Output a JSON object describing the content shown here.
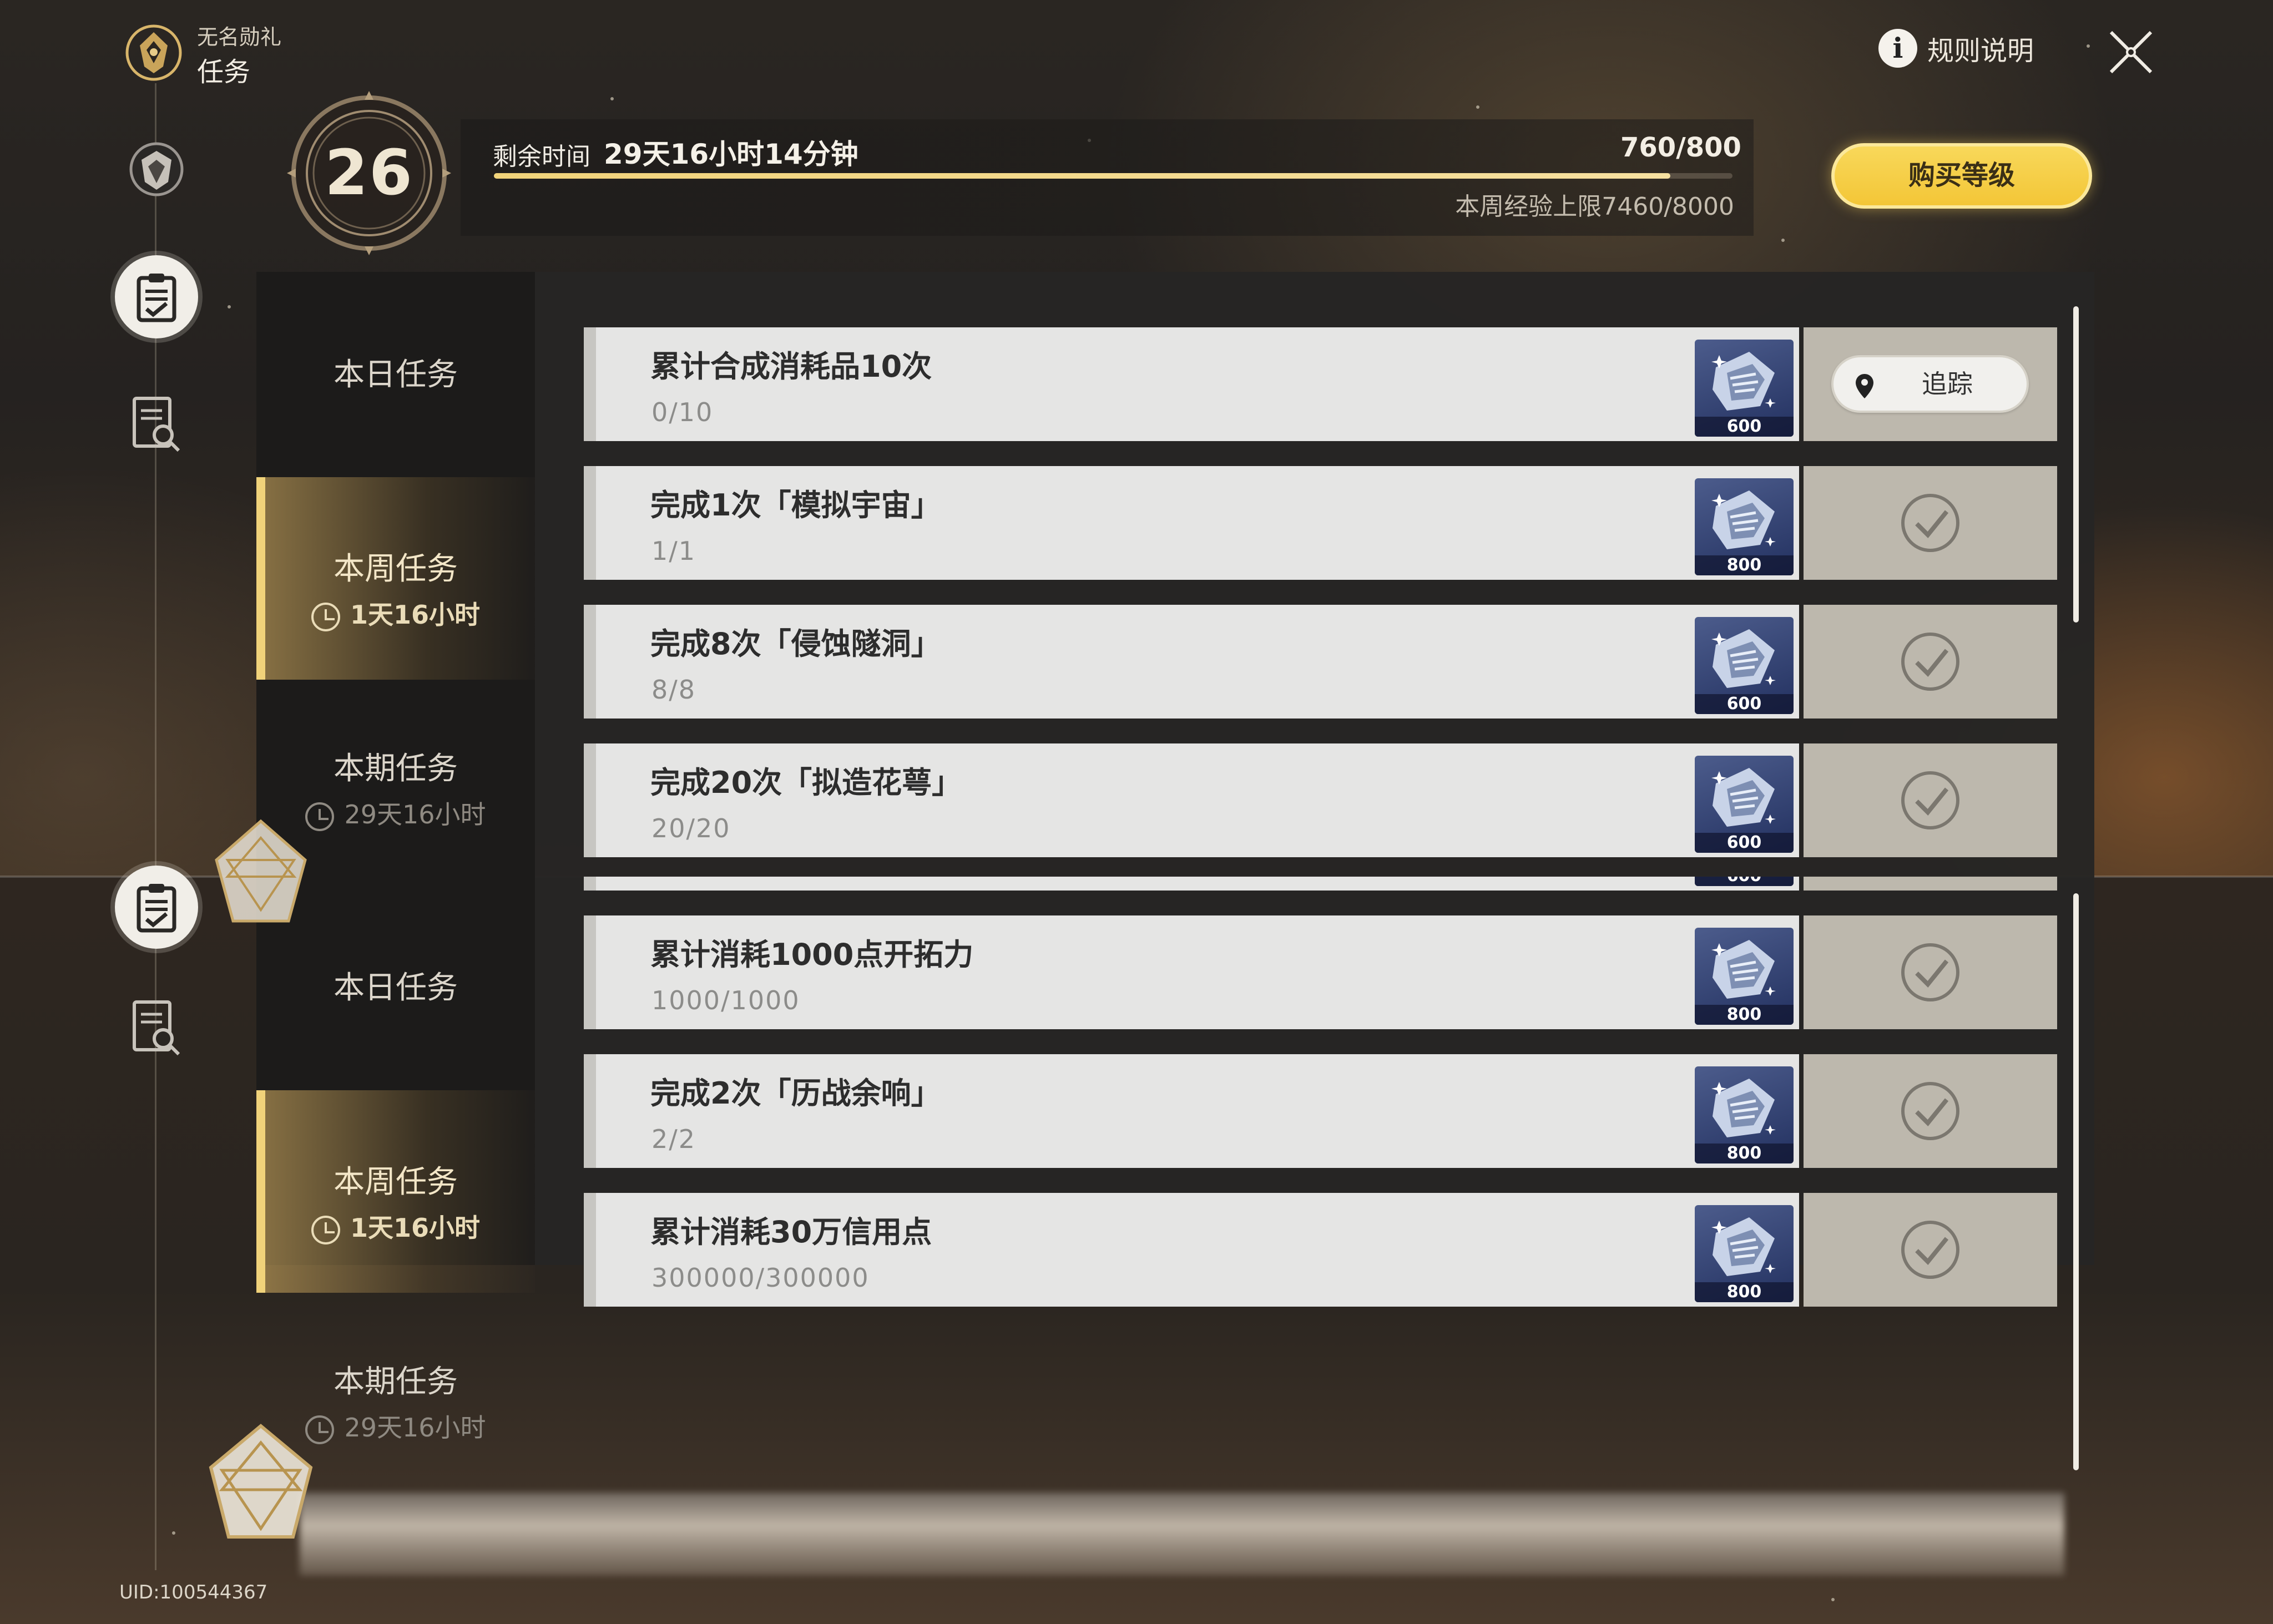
{
  "header": {
    "app_subtitle": "无名勋礼",
    "app_title": "任务",
    "rules_label": "规则说明",
    "level": "26",
    "remaining_label": "剩余时间",
    "remaining_value": "29天16小时14分钟",
    "exp_value": "760/800",
    "exp_progress": 0.95,
    "weekly_cap": "本周经验上限7460/8000",
    "buy_label": "购买等级"
  },
  "tabs": [
    {
      "label": "本日任务",
      "time": ""
    },
    {
      "label": "本周任务",
      "time": "1天16小时"
    },
    {
      "label": "本期任务",
      "time": "29天16小时"
    }
  ],
  "tasks": [
    {
      "title": "累计合成消耗品10次",
      "progress": "0/10",
      "reward": "600",
      "status": "track",
      "track_label": "追踪"
    },
    {
      "title": "完成1次「模拟宇宙」",
      "progress": "1/1",
      "reward": "800",
      "status": "done"
    },
    {
      "title": "完成8次「侵蚀隧洞」",
      "progress": "8/8",
      "reward": "600",
      "status": "done"
    },
    {
      "title": "完成20次「拟造花萼」",
      "progress": "20/20",
      "reward": "600",
      "status": "done"
    },
    {
      "title": "累计消耗1000点开拓力",
      "progress": "1000/1000",
      "reward": "800",
      "status": "done"
    },
    {
      "title": "完成2次「历战余响」",
      "progress": "2/2",
      "reward": "800",
      "status": "done"
    },
    {
      "title": "累计消耗30万信用点",
      "progress": "300000/300000",
      "reward": "800",
      "status": "done"
    }
  ],
  "footer": {
    "uid": "UID:100544367"
  },
  "colors": {
    "accent_gold": "#f3c637",
    "active_tab": "#f0d27a",
    "check_grey": "#7b776f"
  },
  "icons": [
    "medal-icon",
    "shield-icon",
    "clipboard-check-icon",
    "search-document-icon",
    "info-icon",
    "close-icon",
    "clock-icon",
    "location-pin-icon",
    "checkmark-icon",
    "reward-ticket-icon",
    "star-cube-icon"
  ]
}
